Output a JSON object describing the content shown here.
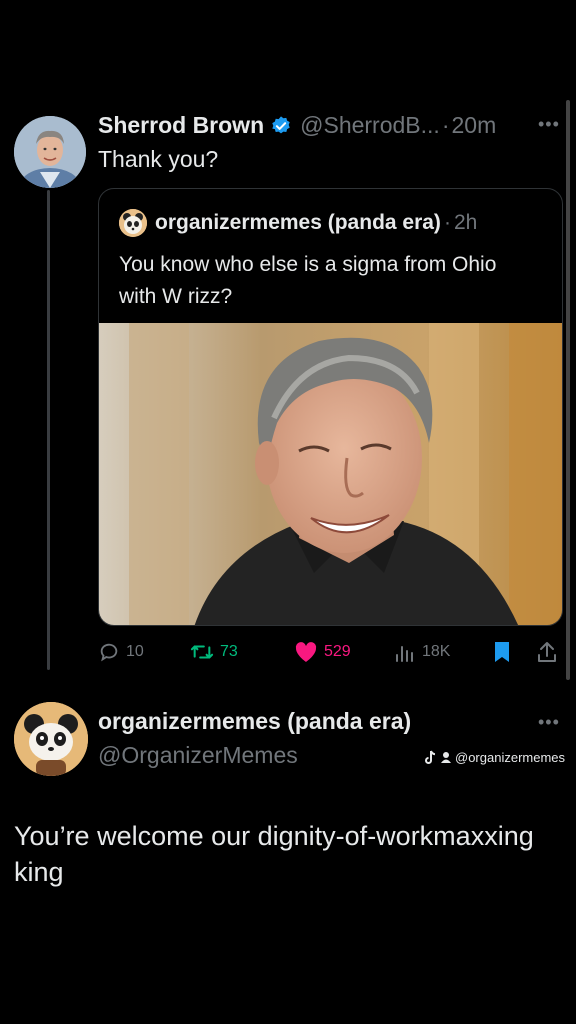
{
  "tweet": {
    "author_name": "Sherrod Brown",
    "author_handle": "@SherrodB...",
    "separator": "·",
    "time": "20m",
    "text": "Thank you?",
    "more_icon": "more-horizontal-icon"
  },
  "quote": {
    "author_name": "organizermemes (panda era)",
    "separator": "·",
    "time": "2h",
    "text": "You know who else is a sigma from Ohio with W rizz?"
  },
  "actions": {
    "replies": "10",
    "retweets": "73",
    "likes": "529",
    "views": "18K",
    "colors": {
      "retweet": "#00ba7c",
      "like": "#f91880",
      "bookmark": "#1d9bf0",
      "muted": "#71767b"
    }
  },
  "reply": {
    "author_name": "organizermemes (panda era)",
    "author_handle": "@OrganizerMemes",
    "text": "You’re welcome our dignity-of-workmaxxing king",
    "watermark": "@organizermemes"
  }
}
